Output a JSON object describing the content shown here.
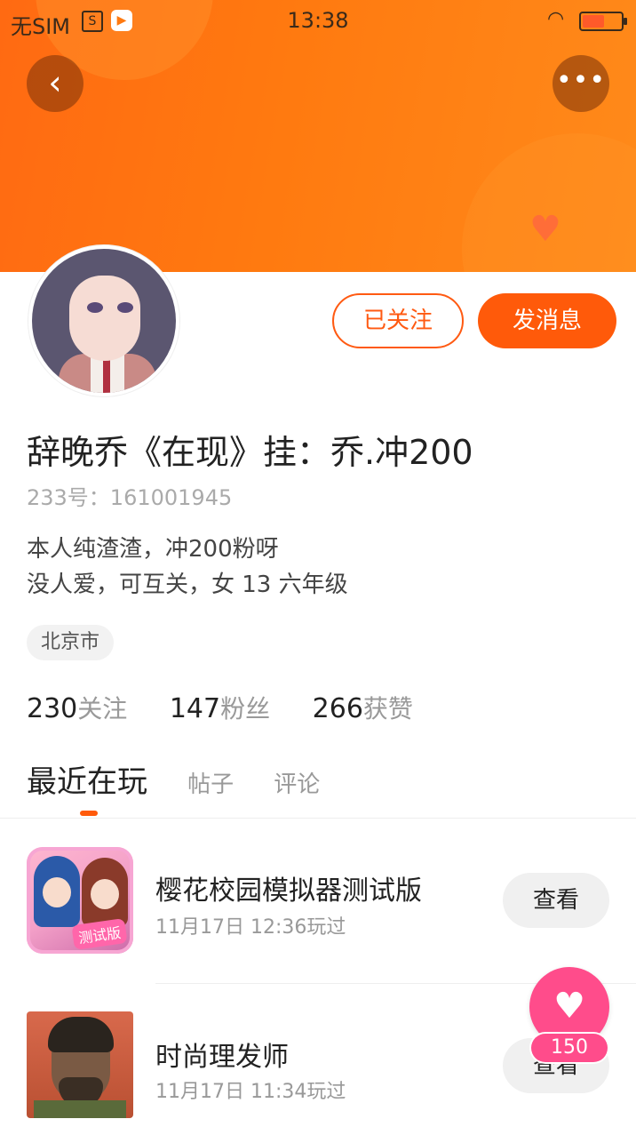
{
  "status_bar": {
    "carrier": "无SIM",
    "time": "13:38"
  },
  "header": {
    "back_icon": "chevron-left-icon",
    "more_icon": "more-dots-icon"
  },
  "profile": {
    "follow_label": "已关注",
    "message_label": "发消息",
    "name": "辞晚乔《在现》挂：乔.冲200",
    "id_text": "233号：161001945",
    "bio_line1": "本人纯渣渣，冲200粉呀",
    "bio_line2": "没人爱，可互关，女 13  六年级",
    "location": "北京市"
  },
  "stats": [
    {
      "value": "230",
      "label": "关注"
    },
    {
      "value": "147",
      "label": "粉丝"
    },
    {
      "value": "266",
      "label": "获赞"
    }
  ],
  "tabs": [
    {
      "label": "最近在玩",
      "active": true
    },
    {
      "label": "帖子",
      "active": false
    },
    {
      "label": "评论",
      "active": false
    }
  ],
  "games": [
    {
      "title": "樱花校园模拟器测试版",
      "time": "11月17日 12:36玩过",
      "button": "查看",
      "icon_badge": "测试版"
    },
    {
      "title": "时尚理发师",
      "time": "11月17日 11:34玩过",
      "button": "查看"
    }
  ],
  "like": {
    "count": "150",
    "icon": "heart-icon"
  },
  "colors": {
    "accent": "#ff5a0a",
    "like": "#ff4c8b"
  }
}
